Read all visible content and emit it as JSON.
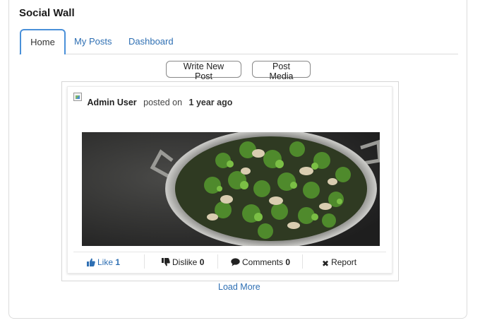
{
  "wall": {
    "title": "Social Wall"
  },
  "tabs": [
    {
      "label": "Home",
      "active": true
    },
    {
      "label": "My Posts",
      "active": false
    },
    {
      "label": "Dashboard",
      "active": false
    }
  ],
  "toolbar": {
    "write_label": "Write New Post",
    "media_label": "Post Media"
  },
  "post": {
    "author": "Admin User",
    "posted_text": "posted on",
    "time": "1 year ago",
    "image_icon": "photo-broccoli-chicken-pan",
    "actions": {
      "like_label": "Like",
      "like_count": "1",
      "dislike_label": "Dislike",
      "dislike_count": "0",
      "comments_label": "Comments",
      "comments_count": "0",
      "report_label": "Report"
    }
  },
  "footer": {
    "load_more": "Load More"
  },
  "colors": {
    "accent": "#2e6fb3",
    "active_tab_border": "#4a90d9"
  }
}
